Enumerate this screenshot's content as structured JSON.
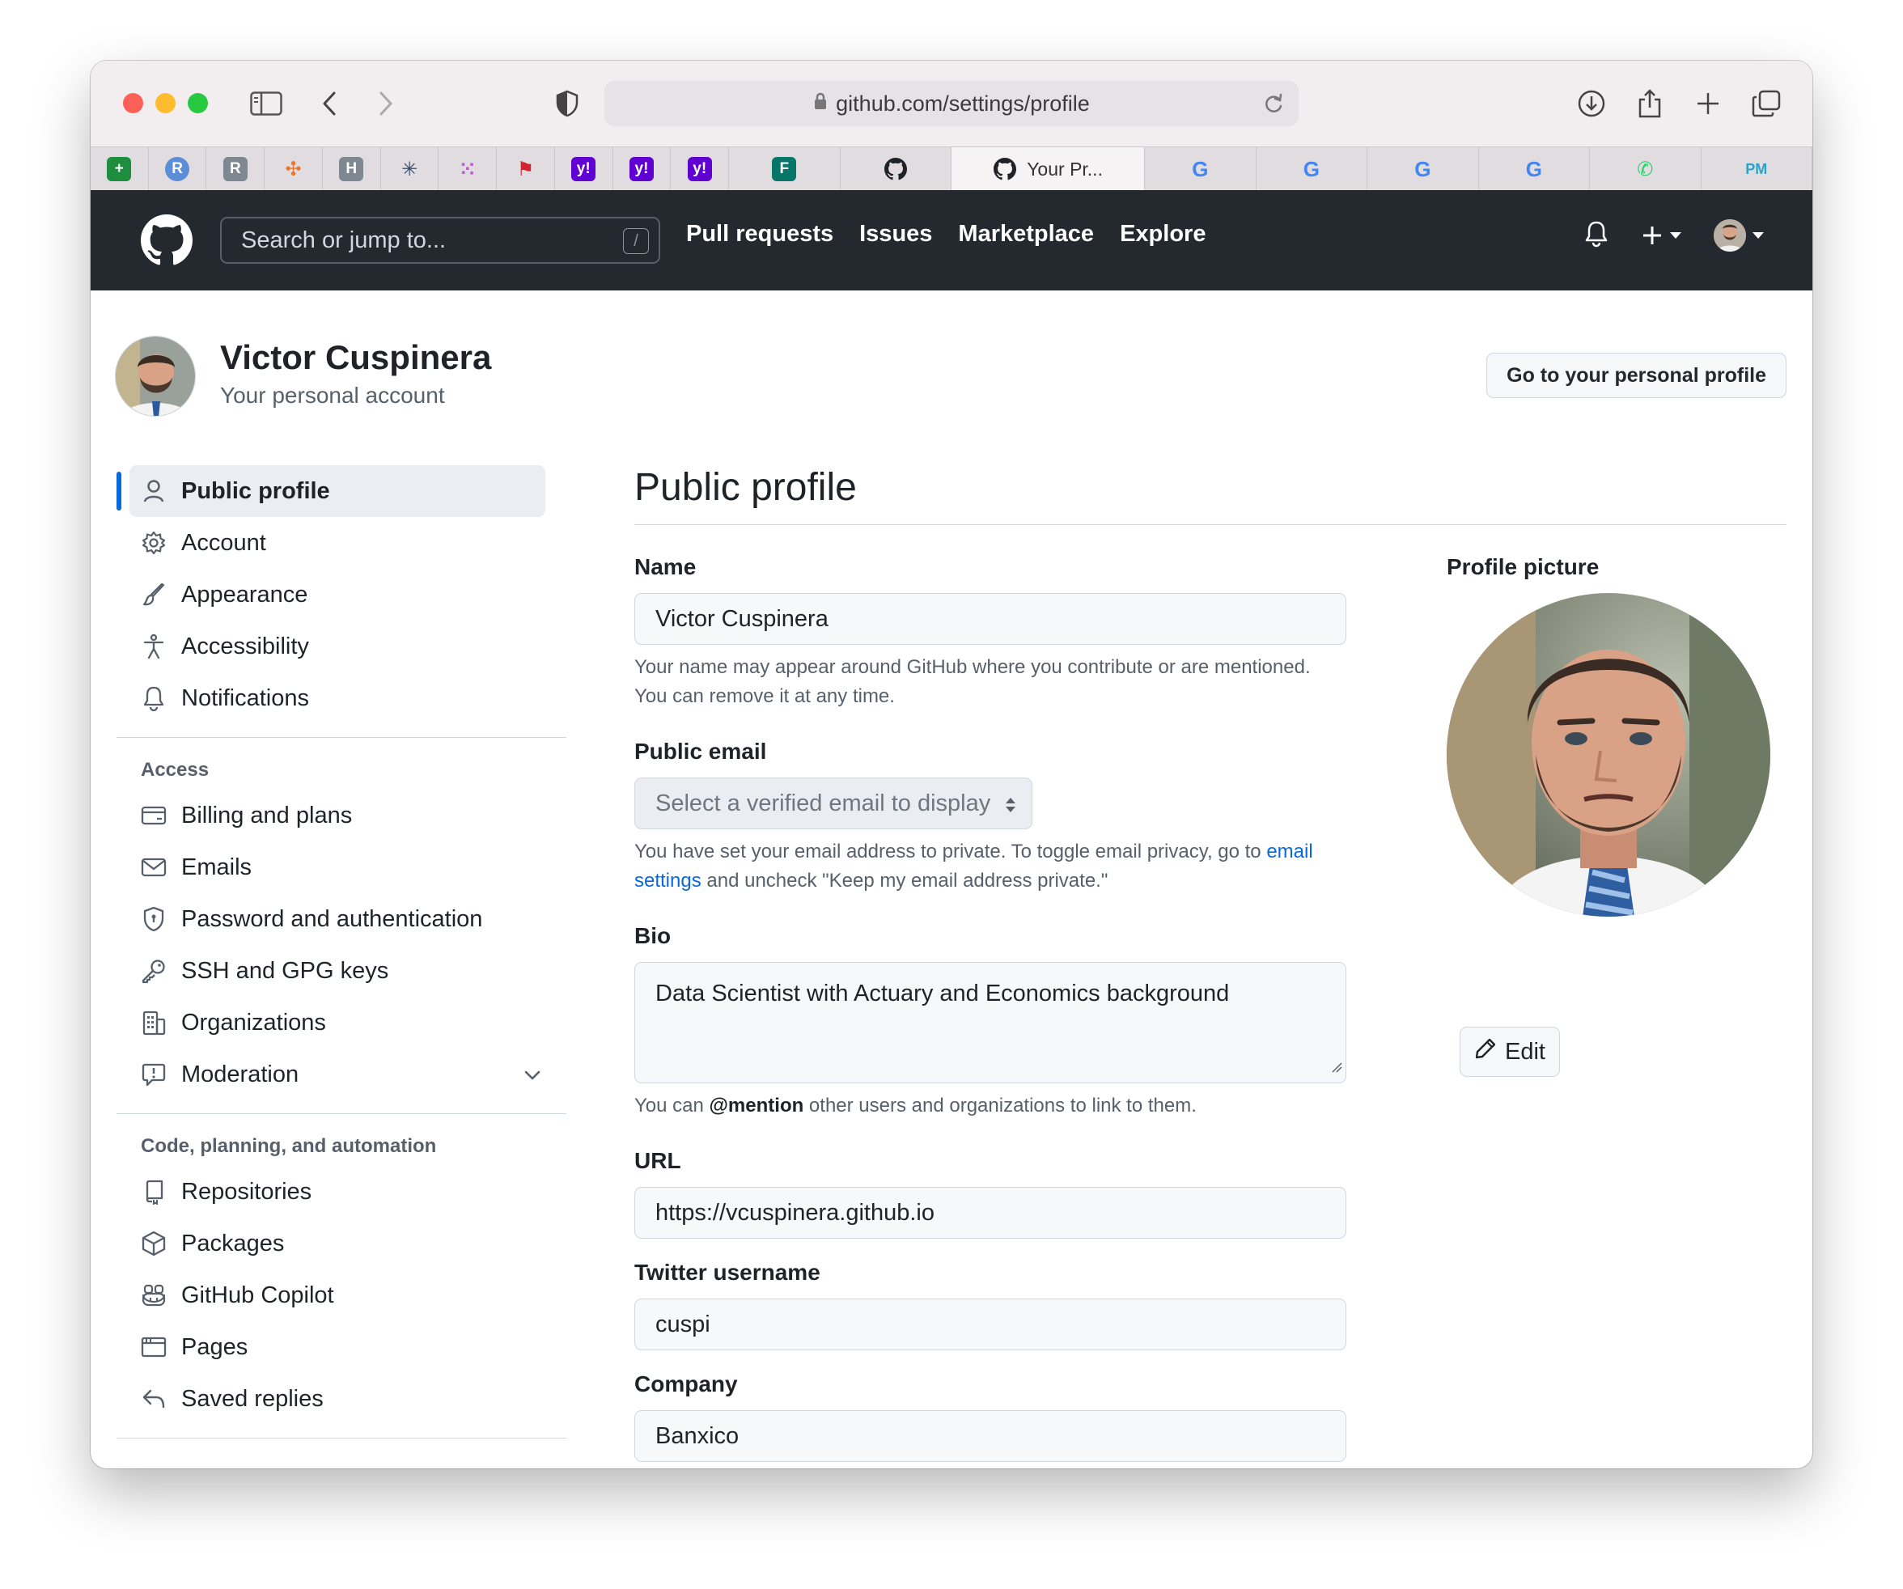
{
  "browser": {
    "url": "github.com/settings/profile",
    "active_tab_title": "Your Pr..."
  },
  "tabs": [
    {
      "icon": "sheets-icon",
      "label": "+",
      "color": "#1e8e3e"
    },
    {
      "icon": "r-circle-icon",
      "label": "R",
      "color": "#5b8ed6"
    },
    {
      "icon": "r-square-icon",
      "label": "R",
      "color": "#7f8791"
    },
    {
      "icon": "tableau-icon",
      "label": "✣",
      "color": "#e8762d"
    },
    {
      "icon": "h-square-icon",
      "label": "H",
      "color": "#7f8791"
    },
    {
      "icon": "spark-icon",
      "label": "✳",
      "color": "#3b4a66"
    },
    {
      "icon": "dots-icon",
      "label": "⁙",
      "color": "#b95cd6"
    },
    {
      "icon": "flag-icon",
      "label": "⚑",
      "color": "#d1242f"
    },
    {
      "icon": "yahoo-icon",
      "label": "y!",
      "color": "#6001d2"
    },
    {
      "icon": "yahoo-icon",
      "label": "y!",
      "color": "#6001d2"
    },
    {
      "icon": "yahoo-icon",
      "label": "y!",
      "color": "#6001d2"
    },
    {
      "icon": "forms-icon",
      "label": "F",
      "color": "#077568"
    },
    {
      "icon": "github-icon",
      "label": "",
      "color": "#24292f"
    },
    {
      "icon": "github-icon",
      "label": "Your Pr...",
      "color": "#24292f"
    },
    {
      "icon": "google-icon",
      "label": "G",
      "color": "#4285f4"
    },
    {
      "icon": "google-icon",
      "label": "G",
      "color": "#4285f4"
    },
    {
      "icon": "google-icon",
      "label": "G",
      "color": "#4285f4"
    },
    {
      "icon": "translate-icon",
      "label": "G",
      "color": "#4285f4"
    },
    {
      "icon": "whatsapp-icon",
      "label": "✆",
      "color": "#25d366"
    },
    {
      "icon": "pm-icon",
      "label": "PM",
      "color": "#2aa2c9"
    }
  ],
  "header": {
    "search_placeholder": "Search or jump to...",
    "search_shortcut": "/",
    "nav": [
      "Pull requests",
      "Issues",
      "Marketplace",
      "Explore"
    ]
  },
  "account": {
    "name": "Victor Cuspinera",
    "subtitle": "Your personal account",
    "profile_button": "Go to your personal profile"
  },
  "sidebar": {
    "top": [
      {
        "label": "Public profile",
        "icon": "person-icon",
        "active": true
      },
      {
        "label": "Account",
        "icon": "gear-icon"
      },
      {
        "label": "Appearance",
        "icon": "paintbrush-icon"
      },
      {
        "label": "Accessibility",
        "icon": "accessibility-icon"
      },
      {
        "label": "Notifications",
        "icon": "bell-icon"
      }
    ],
    "access_heading": "Access",
    "access": [
      {
        "label": "Billing and plans",
        "icon": "credit-card-icon"
      },
      {
        "label": "Emails",
        "icon": "mail-icon"
      },
      {
        "label": "Password and authentication",
        "icon": "shield-icon"
      },
      {
        "label": "SSH and GPG keys",
        "icon": "key-icon"
      },
      {
        "label": "Organizations",
        "icon": "organization-icon"
      },
      {
        "label": "Moderation",
        "icon": "report-icon"
      }
    ],
    "code_heading": "Code, planning, and automation",
    "code": [
      {
        "label": "Repositories",
        "icon": "repo-icon"
      },
      {
        "label": "Packages",
        "icon": "package-icon"
      },
      {
        "label": "GitHub Copilot",
        "icon": "copilot-icon"
      },
      {
        "label": "Pages",
        "icon": "browser-icon"
      },
      {
        "label": "Saved replies",
        "icon": "reply-icon"
      }
    ]
  },
  "main": {
    "title": "Public profile",
    "name_label": "Name",
    "name_value": "Victor Cuspinera",
    "name_note": "Your name may appear around GitHub where you contribute or are mentioned. You can remove it at any time.",
    "email_label": "Public email",
    "email_select": "Select a verified email to display",
    "email_note_1": "You have set your email address to private. To toggle email privacy, go to ",
    "email_note_link": "email settings",
    "email_note_2": " and uncheck \"Keep my email address private.\"",
    "bio_label": "Bio",
    "bio_value": "Data Scientist with Actuary and Economics background",
    "bio_note_1": "You can ",
    "bio_note_mention": "@mention",
    "bio_note_2": " other users and organizations to link to them.",
    "url_label": "URL",
    "url_value": "https://vcuspinera.github.io",
    "twitter_label": "Twitter username",
    "twitter_value": "cuspi",
    "company_label": "Company",
    "company_value": "Banxico",
    "picture_label": "Profile picture",
    "edit_label": "Edit"
  }
}
